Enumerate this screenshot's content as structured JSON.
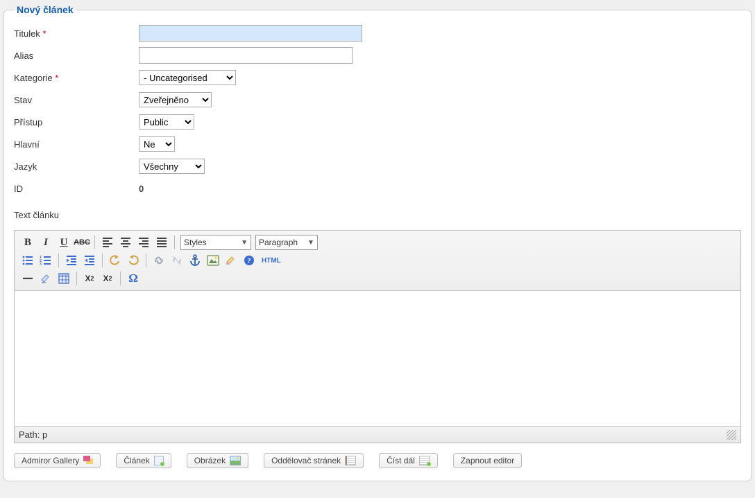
{
  "panel": {
    "title": "Nový článek"
  },
  "form": {
    "titleLabel": "Titulek",
    "titleValue": "",
    "aliasLabel": "Alias",
    "aliasValue": "",
    "categoryLabel": "Kategorie",
    "categoryValue": "- Uncategorised",
    "stateLabel": "Stav",
    "stateValue": "Zveřejněno",
    "accessLabel": "Přístup",
    "accessValue": "Public",
    "featuredLabel": "Hlavní",
    "featuredValue": "Ne",
    "languageLabel": "Jazyk",
    "languageValue": "Všechny",
    "idLabel": "ID",
    "idValue": "0",
    "bodyLabel": "Text článku"
  },
  "editor": {
    "stylesLabel": "Styles",
    "formatLabel": "Paragraph",
    "htmlLabel": "HTML",
    "pathLabel": "Path: p"
  },
  "buttons": {
    "admiror": "Admiror Gallery",
    "article": "Článek",
    "image": "Obrázek",
    "pagebreak": "Oddělovač stránek",
    "readmore": "Číst dál",
    "toggle": "Zapnout editor"
  }
}
